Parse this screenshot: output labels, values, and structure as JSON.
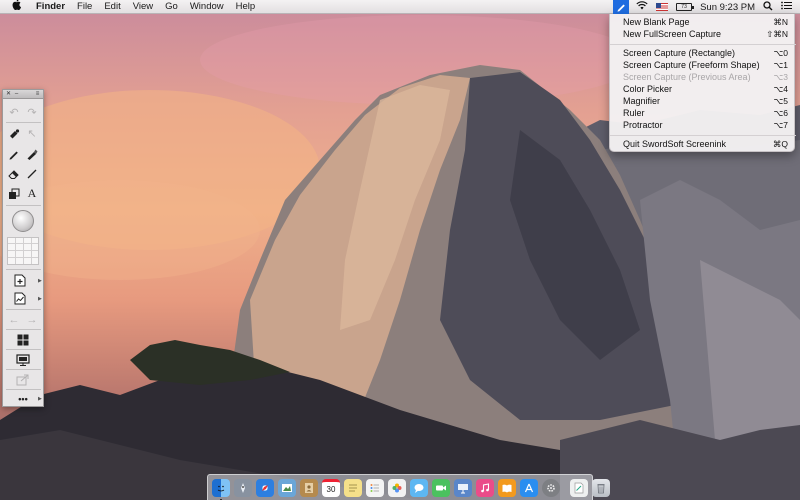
{
  "menubar": {
    "apple_icon": "apple-icon",
    "items": [
      "Finder",
      "File",
      "Edit",
      "View",
      "Go",
      "Window",
      "Help"
    ],
    "status": {
      "battery_label": "73",
      "clock": "Sun 9:23 PM",
      "icons": [
        "screenink-pen-icon",
        "wifi-icon",
        "us-flag-icon",
        "battery-icon",
        "spotlight-icon",
        "notification-center-icon"
      ]
    }
  },
  "dropdown": {
    "items": [
      {
        "label": "New Blank Page",
        "shortcut": "⌘N",
        "enabled": true
      },
      {
        "label": "New FullScreen Capture",
        "shortcut": "⇧⌘N",
        "enabled": true
      },
      {
        "label": "Screen Capture (Rectangle)",
        "shortcut": "⌥0",
        "enabled": true
      },
      {
        "label": "Screen Capture (Freeform Shape)",
        "shortcut": "⌥1",
        "enabled": true
      },
      {
        "label": "Screen Capture (Previous Area)",
        "shortcut": "⌥3",
        "enabled": false
      },
      {
        "label": "Color Picker",
        "shortcut": "⌥4",
        "enabled": true
      },
      {
        "label": "Magnifier",
        "shortcut": "⌥5",
        "enabled": true
      },
      {
        "label": "Ruler",
        "shortcut": "⌥6",
        "enabled": true
      },
      {
        "label": "Protractor",
        "shortcut": "⌥7",
        "enabled": true
      },
      {
        "label": "Quit SwordSoft Screenink",
        "shortcut": "⌘Q",
        "enabled": true
      }
    ]
  },
  "palette": {
    "tools": {
      "undo": "↶",
      "redo": "↷",
      "highlighter": "✎",
      "pointer": "↖",
      "pen": "✎",
      "marker": "✏",
      "eraser": "⌫",
      "line": "╱",
      "stamp": "◧",
      "text": "A",
      "new_page": "＋",
      "chart": "〜",
      "back": "←",
      "forward": "→",
      "grid": "▦",
      "present": "▭",
      "share": "↗",
      "more": "•••"
    }
  },
  "dock": {
    "icons": [
      {
        "name": "finder-icon",
        "color": "#3b8ee8",
        "glyph": "☺"
      },
      {
        "name": "launchpad-icon",
        "color": "#7b8593",
        "glyph": "🚀"
      },
      {
        "name": "safari-icon",
        "color": "#2d7fe0",
        "glyph": "◎"
      },
      {
        "name": "preview-icon",
        "color": "#6aa6d8",
        "glyph": "▧"
      },
      {
        "name": "contacts-icon",
        "color": "#b58a4d",
        "glyph": "☰"
      },
      {
        "name": "calendar-icon",
        "color": "#f4f4f4",
        "glyph": "30"
      },
      {
        "name": "notes-icon",
        "color": "#f5e08a",
        "glyph": "≡"
      },
      {
        "name": "reminders-icon",
        "color": "#f4f4f4",
        "glyph": "☰"
      },
      {
        "name": "photos-icon",
        "color": "#e8c26b",
        "glyph": "✿"
      },
      {
        "name": "messages-icon",
        "color": "#5db7f2",
        "glyph": "💬"
      },
      {
        "name": "facetime-icon",
        "color": "#4bc15f",
        "glyph": "▶"
      },
      {
        "name": "keynote-icon",
        "color": "#5a86c9",
        "glyph": "▤"
      },
      {
        "name": "itunes-icon",
        "color": "#ea4c89",
        "glyph": "♫"
      },
      {
        "name": "ibooks-icon",
        "color": "#f39a1d",
        "glyph": "▥"
      },
      {
        "name": "app-store-icon",
        "color": "#2a8ef0",
        "glyph": "A"
      },
      {
        "name": "system-preferences-icon",
        "color": "#7d7f83",
        "glyph": "⚙"
      },
      {
        "name": "screenink-doc-icon",
        "color": "#eef0f0",
        "glyph": "▤"
      },
      {
        "name": "trash-icon",
        "color": "#c9cdd2",
        "glyph": "🗑"
      }
    ]
  }
}
